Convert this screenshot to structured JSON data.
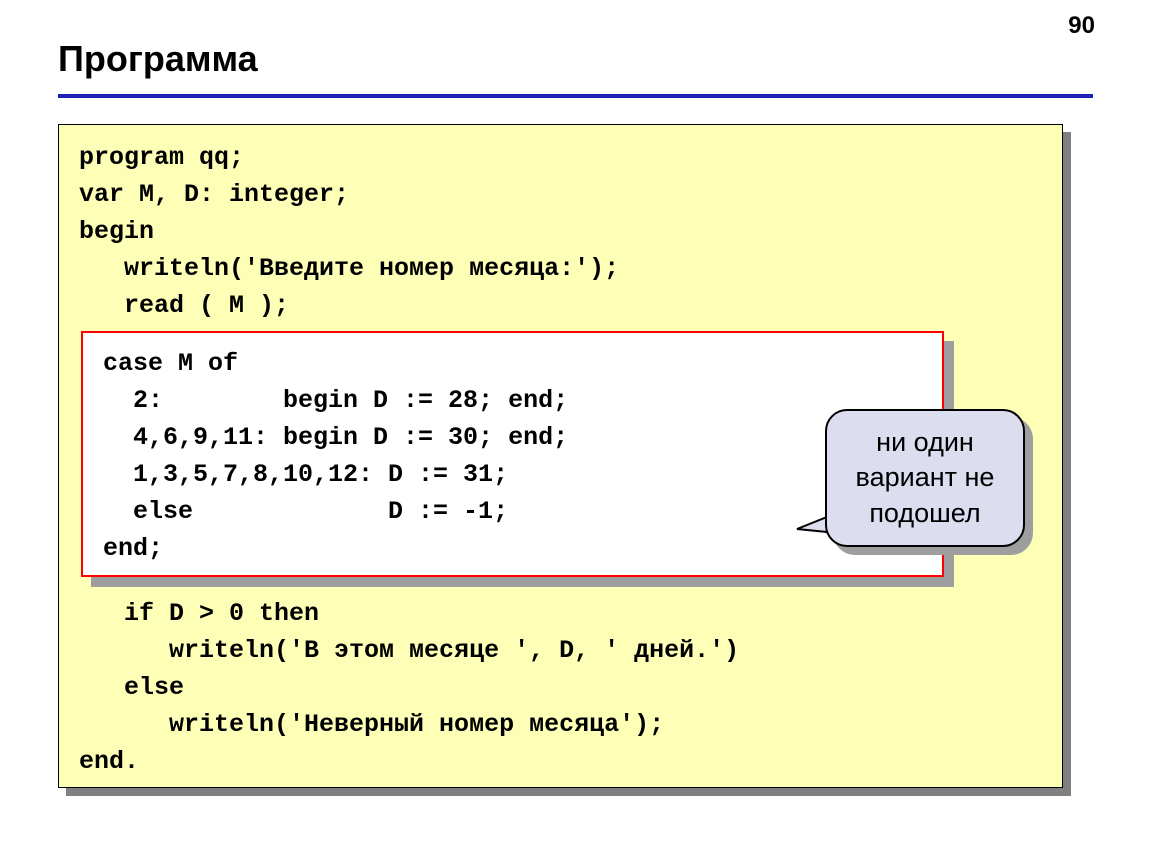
{
  "page_number": "90",
  "title": "Программа",
  "code": {
    "top": "program qq;\nvar M, D: integer;\nbegin\n   writeln('Введите номер месяца:');\n   read ( M );",
    "white": "case M of\n  2:        begin D := 28; end;\n  4,6,9,11: begin D := 30; end;\n  1,3,5,7,8,10,12: D := 31;\n  else             D := -1;\nend;",
    "bottom": "   if D > 0 then\n      writeln('В этом месяце ', D, ' дней.')\n   else\n      writeln('Неверный номер месяца');\nend."
  },
  "callout": "ни один\nвариант не\nподошел"
}
